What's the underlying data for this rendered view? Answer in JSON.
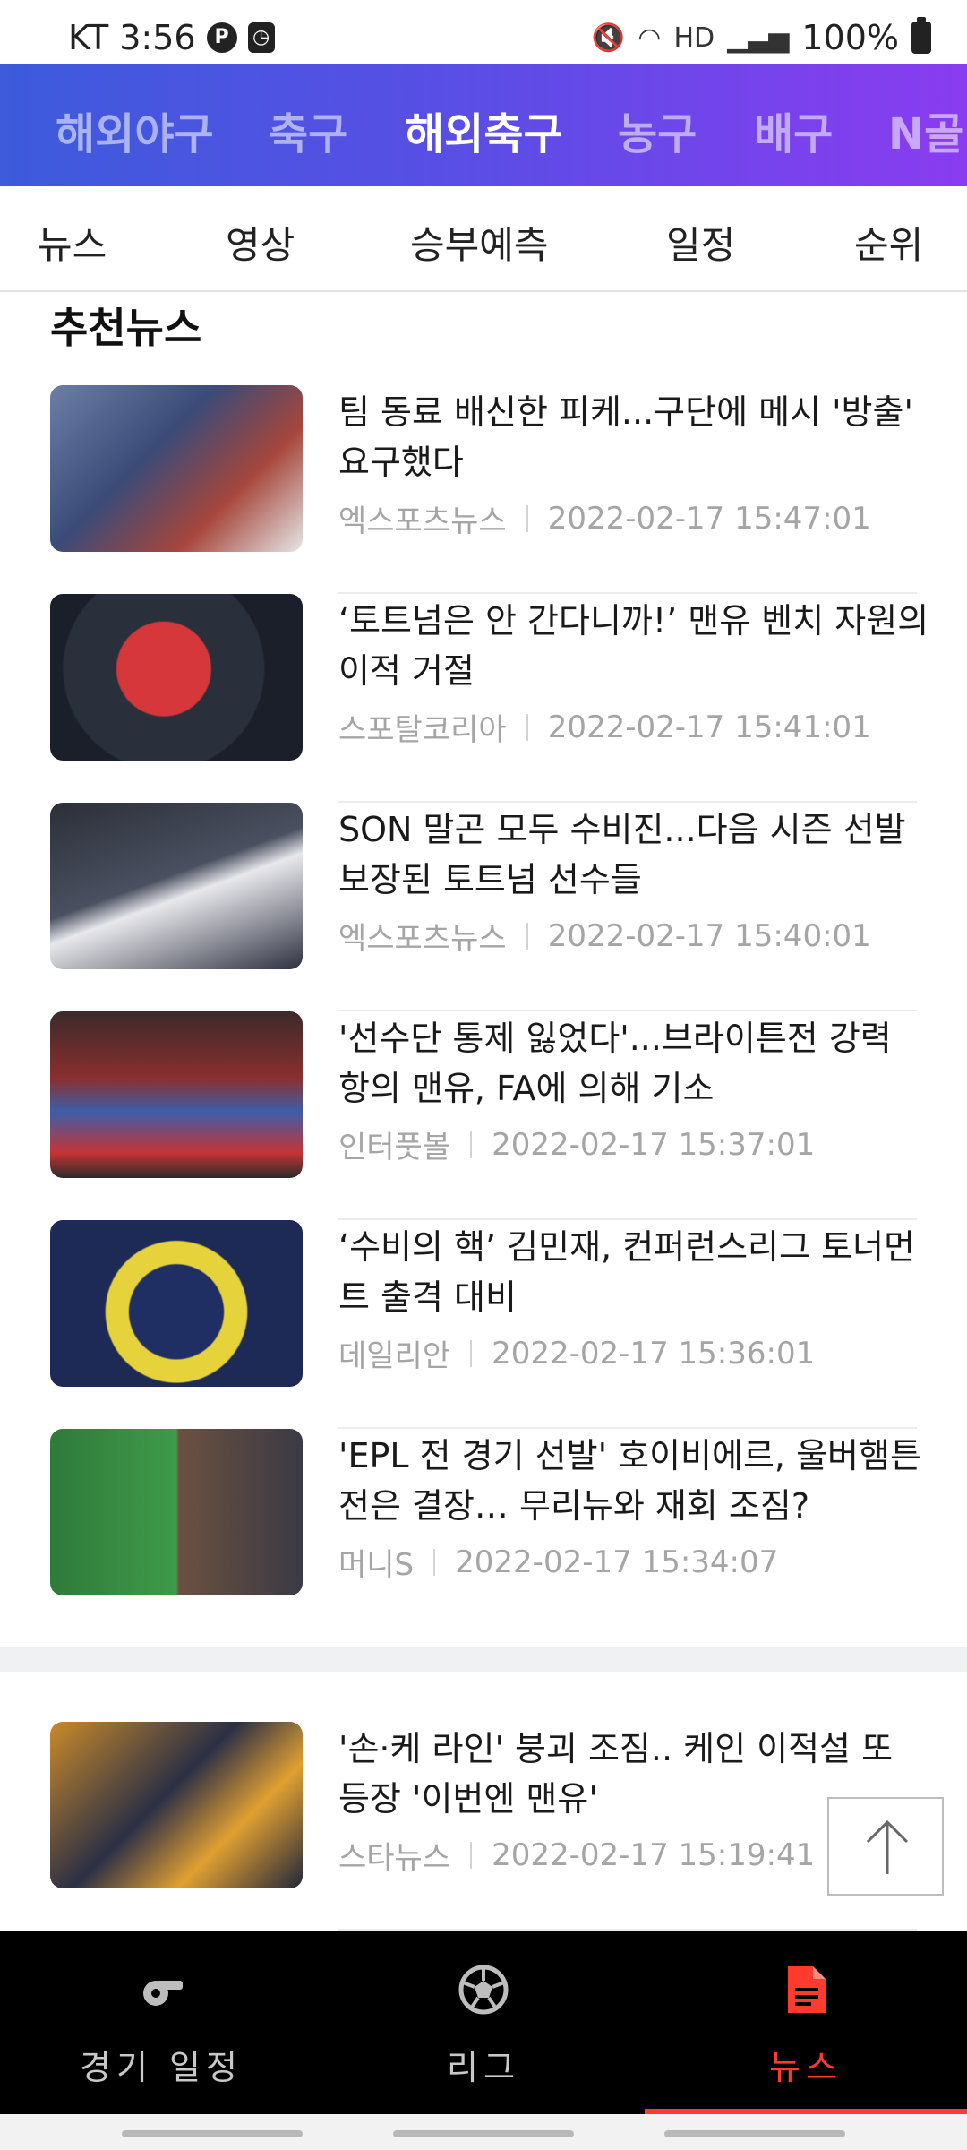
{
  "status_bar": {
    "carrier_time": "KT 3:56",
    "network": "HD",
    "battery": "100%"
  },
  "sport_tabs": [
    {
      "label": "해외야구",
      "active": false
    },
    {
      "label": "축구",
      "active": false
    },
    {
      "label": "해외축구",
      "active": true
    },
    {
      "label": "농구",
      "active": false
    },
    {
      "label": "배구",
      "active": false
    },
    {
      "label": "N골",
      "active": false
    }
  ],
  "sub_tabs": [
    "뉴스",
    "영상",
    "승부예측",
    "일정",
    "순위"
  ],
  "section_title": "추천뉴스",
  "news": [
    {
      "title": "팀 동료 배신한 피케...구단에 메시 '방출' 요구했다",
      "source": "엑스포츠뉴스",
      "time": "2022-02-17 15:47:01"
    },
    {
      "title": "‘토트넘은 안 간다니까!’ 맨유 벤치 자원의 이적 거절",
      "source": "스포탈코리아",
      "time": "2022-02-17 15:41:01"
    },
    {
      "title": "SON 말곤 모두 수비진...다음 시즌 선발 보장된 토트넘 선수들",
      "source": "엑스포츠뉴스",
      "time": "2022-02-17 15:40:01"
    },
    {
      "title": "'선수단 통제 잃었다'...브라이튼전 강력 항의 맨유, FA에 의해 기소",
      "source": "인터풋볼",
      "time": "2022-02-17 15:37:01"
    },
    {
      "title": "‘수비의 핵’ 김민재, 컨퍼런스리그 토너먼트 출격 대비",
      "source": "데일리안",
      "time": "2022-02-17 15:36:01"
    },
    {
      "title": "'EPL 전 경기 선발' 호이비에르, 울버햄튼전은 결장… 무리뉴와 재회 조짐?",
      "source": "머니S",
      "time": "2022-02-17 15:34:07"
    }
  ],
  "news_more": [
    {
      "title": "'손·케 라인' 붕괴 조짐.. 케인 이적설 또 등장 '이번엔 맨유'",
      "source": "스타뉴스",
      "time": "2022-02-17 15:19:41"
    }
  ],
  "bottom_nav": [
    {
      "label": "경기 일정",
      "icon": "whistle-icon",
      "active": false
    },
    {
      "label": "리그",
      "icon": "soccer-ball-icon",
      "active": false
    },
    {
      "label": "뉴스",
      "icon": "news-document-icon",
      "active": true
    }
  ],
  "colors": {
    "accent": "#ff3b30",
    "header_gradient_start": "#3d5bdc",
    "header_gradient_end": "#8a3cf0"
  }
}
